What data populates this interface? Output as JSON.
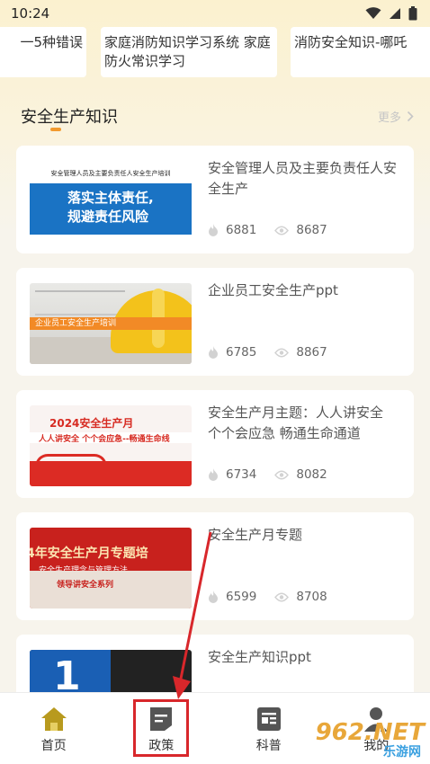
{
  "status_bar": {
    "time": "10:24",
    "icons": [
      "wifi-icon",
      "signal-icon",
      "battery-icon"
    ]
  },
  "top_chips": [
    {
      "text": "一5种错误"
    },
    {
      "text": "家庭消防知识学习系统 家庭防火常识学习"
    },
    {
      "text": "消防安全知识-哪吒"
    }
  ],
  "section": {
    "title": "安全生产知识",
    "more": "更多",
    "accent": "#f29a2e"
  },
  "articles": [
    {
      "title": "安全管理人员及主要负责任人安全生产",
      "likes": "6881",
      "views": "8687",
      "thumb": {
        "top_text": "安全管理人员及主要负责任人安全生产培训",
        "line1": "落实主体责任,",
        "line2": "规避责任风险"
      }
    },
    {
      "title": "企业员工安全生产ppt",
      "likes": "6785",
      "views": "8867",
      "thumb": {
        "banner": "企业员工安全生产培训"
      }
    },
    {
      "title": "安全生产月主题：人人讲安全 个个会应急 畅通生命通道",
      "likes": "6734",
      "views": "8082",
      "thumb": {
        "title": "2024安全生产月",
        "sub": "人人讲安全 个个会应急--畅通生命线"
      }
    },
    {
      "title": "安全生产月专题",
      "likes": "6599",
      "views": "8708",
      "thumb": {
        "title": "4年安全生产月专题培",
        "sub": "安全生产理念与管理方法",
        "tag": "领导讲安全系列"
      }
    },
    {
      "title": "安全生产知识ppt",
      "thumb": {
        "number": "1"
      }
    }
  ],
  "bottom_nav": [
    {
      "label": "首页",
      "icon": "home-icon",
      "color": "#b89a1e"
    },
    {
      "label": "政策",
      "icon": "policy-icon",
      "color": "#555555"
    },
    {
      "label": "科普",
      "icon": "science-icon",
      "color": "#555555"
    },
    {
      "label": "我的",
      "icon": "user-icon",
      "color": "#555555"
    }
  ],
  "annotation": {
    "color": "#d8272b"
  },
  "watermark": {
    "main": "962.NET",
    "sub": "乐游网"
  }
}
